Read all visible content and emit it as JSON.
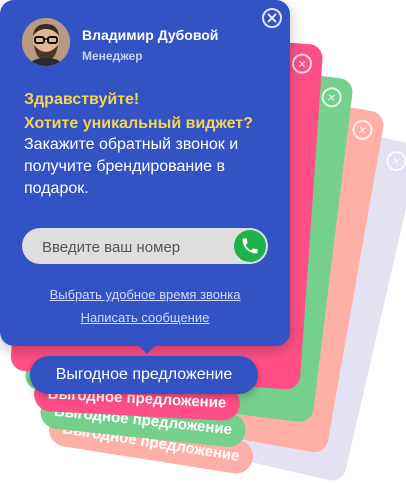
{
  "manager": {
    "name": "Владимир Дубовой",
    "role": "Менеджер"
  },
  "greeting": {
    "line1": "Здравствуйте!",
    "line2": "Хотите уникальный виджет?"
  },
  "offer_text": "Закажите обратный звонок и получите брендирование в подарок.",
  "phone": {
    "placeholder": "Введите ваш номер",
    "value": ""
  },
  "links": {
    "choose_time": "Выбрать удобное время звонка",
    "write_message": "Написать сообщение"
  },
  "promo_button": "Выгодное предложение",
  "ghost_label": "Выгодное предложение",
  "colors": {
    "primary": "#3353c5",
    "accent": "#f7d353",
    "call": "#1fb24a",
    "pink": "#ff4f86",
    "green": "#75d08c",
    "salmon": "#ffb0a6",
    "lavender": "#e3e1f2"
  },
  "icons": {
    "close": "close-icon",
    "call": "phone-icon"
  }
}
